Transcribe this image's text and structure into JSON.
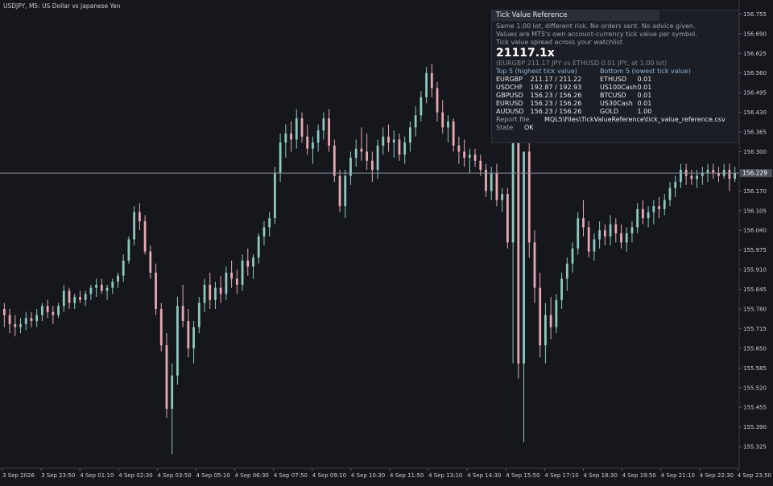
{
  "title": "USDJPY, M5:  US Dollar vs Japanese Yen",
  "price_axis": {
    "ticks": [
      "156.755",
      "156.690",
      "156.625",
      "156.560",
      "156.495",
      "156.430",
      "156.365",
      "156.300",
      "156.235",
      "156.170",
      "156.105",
      "156.040",
      "155.975",
      "155.910",
      "155.845",
      "155.780",
      "155.715",
      "155.650",
      "155.585",
      "155.520",
      "155.455",
      "155.390",
      "155.325"
    ],
    "current_price": "156.229"
  },
  "time_axis": {
    "labels": [
      "3 Sep 2026",
      "3 Sep 23:50",
      "4 Sep 01:10",
      "4 Sep 02:30",
      "4 Sep 03:50",
      "4 Sep 05:10",
      "4 Sep 06:30",
      "4 Sep 07:50",
      "4 Sep 09:10",
      "4 Sep 10:30",
      "4 Sep 11:50",
      "4 Sep 13:10",
      "4 Sep 14:30",
      "4 Sep 15:50",
      "4 Sep 17:10",
      "4 Sep 18:30",
      "4 Sep 19:50",
      "4 Sep 21:10",
      "4 Sep 22:30",
      "4 Sep 23:50"
    ]
  },
  "colors": {
    "background": "#15171c",
    "bull": "#8fc9bd",
    "bear": "#e8a9b3",
    "text": "#c8ccd4",
    "crosshair": "#8a8f98"
  },
  "panel": {
    "header": "Tick Value Reference",
    "lines": [
      "Same 1.00 lot, different risk. No orders sent. No advice given.",
      "Values are MT5's own account-currency tick value per symbol.",
      "Tick value spread across your watchlist"
    ],
    "ratio": "21117.1x",
    "ratio_detail": "(EURGBP 211.17 JPY vs ETHUSD 0.01 JPY, at 1.00 lot)",
    "top_header": "Top 5 (highest tick value)",
    "bottom_header": "Bottom 5 (lowest tick value)",
    "top": [
      {
        "symbol": "EURGBP",
        "value": "211.17 / 211.22"
      },
      {
        "symbol": "USDCHF",
        "value": "192.87 / 192.93"
      },
      {
        "symbol": "GBPUSD",
        "value": "156.23 / 156.26"
      },
      {
        "symbol": "EURUSD",
        "value": "156.23 / 156.26"
      },
      {
        "symbol": "AUDUSD",
        "value": "156.23 / 156.26"
      }
    ],
    "bottom": [
      {
        "symbol": "ETHUSD",
        "value": "0.01"
      },
      {
        "symbol": "US100Cash",
        "value": "0.01"
      },
      {
        "symbol": "BTCUSD",
        "value": "0.01"
      },
      {
        "symbol": "US30Cash",
        "value": "0.01"
      },
      {
        "symbol": "GOLD",
        "value": "1.00"
      }
    ],
    "report_label": "Report file",
    "report_value": "MQL5\\Files\\TickValueReference\\tick_value_reference.csv",
    "state_label": "State",
    "state_value": "OK"
  },
  "chart_data": {
    "type": "candlestick",
    "symbol": "USDJPY",
    "timeframe": "M5",
    "ylim": [
      155.28,
      156.78
    ],
    "grid": false,
    "candles": [
      [
        155.78,
        155.8,
        155.72,
        155.76
      ],
      [
        155.76,
        155.78,
        155.7,
        155.73
      ],
      [
        155.73,
        155.76,
        155.69,
        155.72
      ],
      [
        155.72,
        155.75,
        155.7,
        155.73
      ],
      [
        155.73,
        155.77,
        155.71,
        155.75
      ],
      [
        155.75,
        155.77,
        155.72,
        155.74
      ],
      [
        155.74,
        155.78,
        155.72,
        155.76
      ],
      [
        155.76,
        155.8,
        155.74,
        155.79
      ],
      [
        155.79,
        155.81,
        155.75,
        155.77
      ],
      [
        155.77,
        155.79,
        155.73,
        155.76
      ],
      [
        155.76,
        155.8,
        155.75,
        155.79
      ],
      [
        155.79,
        155.86,
        155.77,
        155.84
      ],
      [
        155.84,
        155.85,
        155.78,
        155.8
      ],
      [
        155.8,
        155.83,
        155.78,
        155.82
      ],
      [
        155.82,
        155.84,
        155.8,
        155.81
      ],
      [
        155.81,
        155.84,
        155.79,
        155.83
      ],
      [
        155.83,
        155.86,
        155.81,
        155.85
      ],
      [
        155.85,
        155.88,
        155.82,
        155.86
      ],
      [
        155.86,
        155.88,
        155.83,
        155.84
      ],
      [
        155.84,
        155.86,
        155.81,
        155.85
      ],
      [
        155.85,
        155.88,
        155.83,
        155.87
      ],
      [
        155.87,
        155.9,
        155.85,
        155.89
      ],
      [
        155.89,
        155.96,
        155.87,
        155.94
      ],
      [
        155.94,
        156.02,
        155.93,
        156.01
      ],
      [
        156.01,
        156.12,
        155.99,
        156.1
      ],
      [
        156.1,
        156.13,
        156.04,
        156.07
      ],
      [
        156.07,
        156.09,
        155.96,
        155.97
      ],
      [
        155.97,
        155.99,
        155.88,
        155.9
      ],
      [
        155.9,
        155.93,
        155.76,
        155.78
      ],
      [
        155.78,
        155.8,
        155.64,
        155.66
      ],
      [
        155.66,
        155.7,
        155.42,
        155.45
      ],
      [
        155.45,
        155.6,
        155.3,
        155.56
      ],
      [
        155.56,
        155.82,
        155.53,
        155.79
      ],
      [
        155.79,
        155.86,
        155.72,
        155.74
      ],
      [
        155.74,
        155.78,
        155.62,
        155.65
      ],
      [
        155.65,
        155.74,
        155.6,
        155.72
      ],
      [
        155.72,
        155.82,
        155.7,
        155.8
      ],
      [
        155.8,
        155.88,
        155.77,
        155.86
      ],
      [
        155.86,
        155.9,
        155.78,
        155.81
      ],
      [
        155.81,
        155.87,
        155.78,
        155.85
      ],
      [
        155.85,
        155.89,
        155.8,
        155.83
      ],
      [
        155.83,
        155.92,
        155.81,
        155.9
      ],
      [
        155.9,
        155.94,
        155.85,
        155.88
      ],
      [
        155.88,
        155.91,
        155.83,
        155.86
      ],
      [
        155.86,
        155.96,
        155.84,
        155.94
      ],
      [
        155.94,
        155.98,
        155.89,
        155.92
      ],
      [
        155.92,
        155.96,
        155.88,
        155.95
      ],
      [
        155.95,
        156.03,
        155.93,
        156.02
      ],
      [
        156.02,
        156.07,
        155.99,
        156.05
      ],
      [
        156.05,
        156.1,
        156.02,
        156.08
      ],
      [
        156.08,
        156.25,
        156.06,
        156.23
      ],
      [
        156.23,
        156.36,
        156.2,
        156.33
      ],
      [
        156.33,
        156.39,
        156.28,
        156.36
      ],
      [
        156.36,
        156.4,
        156.3,
        156.34
      ],
      [
        156.34,
        156.44,
        156.31,
        156.41
      ],
      [
        156.41,
        156.43,
        156.33,
        156.35
      ],
      [
        156.35,
        156.39,
        156.29,
        156.31
      ],
      [
        156.31,
        156.35,
        156.26,
        156.33
      ],
      [
        156.33,
        156.39,
        156.3,
        156.37
      ],
      [
        156.37,
        156.43,
        156.34,
        156.41
      ],
      [
        156.41,
        156.44,
        156.3,
        156.32
      ],
      [
        156.32,
        156.34,
        156.2,
        156.22
      ],
      [
        156.22,
        156.24,
        156.1,
        156.12
      ],
      [
        156.12,
        156.24,
        156.08,
        156.22
      ],
      [
        156.22,
        156.3,
        156.19,
        156.28
      ],
      [
        156.28,
        156.34,
        156.25,
        156.31
      ],
      [
        156.31,
        156.38,
        156.27,
        156.3
      ],
      [
        156.3,
        156.36,
        156.24,
        156.27
      ],
      [
        156.27,
        156.3,
        156.2,
        156.24
      ],
      [
        156.24,
        156.34,
        156.21,
        156.32
      ],
      [
        156.32,
        156.38,
        156.29,
        156.35
      ],
      [
        156.35,
        156.39,
        156.3,
        156.33
      ],
      [
        156.33,
        156.37,
        156.28,
        156.34
      ],
      [
        156.34,
        156.36,
        156.27,
        156.29
      ],
      [
        156.29,
        156.35,
        156.26,
        156.33
      ],
      [
        156.33,
        156.4,
        156.3,
        156.38
      ],
      [
        156.38,
        156.45,
        156.35,
        156.42
      ],
      [
        156.42,
        156.5,
        156.4,
        156.48
      ],
      [
        156.48,
        156.58,
        156.46,
        156.56
      ],
      [
        156.56,
        156.59,
        156.48,
        156.51
      ],
      [
        156.51,
        156.53,
        156.4,
        156.43
      ],
      [
        156.43,
        156.47,
        156.36,
        156.38
      ],
      [
        156.38,
        156.42,
        156.33,
        156.4
      ],
      [
        156.4,
        156.41,
        156.3,
        156.32
      ],
      [
        156.32,
        156.35,
        156.26,
        156.3
      ],
      [
        156.3,
        156.34,
        156.25,
        156.28
      ],
      [
        156.28,
        156.31,
        156.23,
        156.29
      ],
      [
        156.29,
        156.31,
        156.25,
        156.27
      ],
      [
        156.27,
        156.29,
        156.22,
        156.24
      ],
      [
        156.24,
        156.26,
        156.15,
        156.17
      ],
      [
        156.17,
        156.25,
        156.14,
        156.23
      ],
      [
        156.23,
        156.26,
        156.12,
        156.14
      ],
      [
        156.14,
        156.18,
        156.1,
        156.16
      ],
      [
        156.16,
        156.18,
        155.98,
        156.0
      ],
      [
        156.0,
        156.05,
        155.6,
        156.35
      ],
      [
        156.35,
        156.42,
        155.55,
        155.6
      ],
      [
        155.6,
        156.28,
        155.34,
        156.3
      ],
      [
        156.3,
        156.36,
        155.95,
        156.0
      ],
      [
        156.0,
        156.04,
        155.8,
        155.85
      ],
      [
        155.85,
        155.9,
        155.62,
        155.66
      ],
      [
        155.66,
        155.8,
        155.6,
        155.76
      ],
      [
        155.76,
        155.82,
        155.68,
        155.72
      ],
      [
        155.72,
        155.83,
        155.7,
        155.81
      ],
      [
        155.81,
        155.9,
        155.78,
        155.88
      ],
      [
        155.88,
        155.95,
        155.84,
        155.93
      ],
      [
        155.93,
        156.0,
        155.9,
        155.98
      ],
      [
        155.98,
        156.1,
        155.96,
        156.08
      ],
      [
        156.08,
        156.14,
        156.02,
        156.05
      ],
      [
        156.05,
        156.07,
        155.95,
        155.97
      ],
      [
        155.97,
        156.03,
        155.94,
        156.01
      ],
      [
        156.01,
        156.07,
        155.98,
        156.04
      ],
      [
        156.04,
        156.06,
        155.99,
        156.02
      ],
      [
        156.02,
        156.09,
        155.99,
        156.06
      ],
      [
        156.06,
        156.08,
        156.0,
        156.03
      ],
      [
        156.03,
        156.06,
        155.98,
        156.0
      ],
      [
        156.0,
        156.05,
        155.97,
        156.03
      ],
      [
        156.03,
        156.07,
        156.0,
        156.05
      ],
      [
        156.05,
        156.13,
        156.03,
        156.11
      ],
      [
        156.11,
        156.14,
        156.06,
        156.08
      ],
      [
        156.08,
        156.12,
        156.05,
        156.1
      ],
      [
        156.1,
        156.14,
        156.06,
        156.12
      ],
      [
        156.12,
        156.15,
        156.08,
        156.11
      ],
      [
        156.11,
        156.16,
        156.09,
        156.14
      ],
      [
        156.14,
        156.2,
        156.12,
        156.18
      ],
      [
        156.18,
        156.22,
        156.15,
        156.2
      ],
      [
        156.2,
        156.26,
        156.18,
        156.24
      ],
      [
        156.24,
        156.26,
        156.19,
        156.22
      ],
      [
        156.22,
        156.24,
        156.19,
        156.21
      ],
      [
        156.21,
        156.24,
        156.18,
        156.22
      ],
      [
        156.22,
        156.25,
        156.19,
        156.23
      ],
      [
        156.23,
        156.26,
        156.2,
        156.24
      ],
      [
        156.24,
        156.26,
        156.21,
        156.23
      ],
      [
        156.23,
        156.25,
        156.2,
        156.22
      ],
      [
        156.22,
        156.26,
        156.21,
        156.24
      ],
      [
        156.24,
        156.26,
        156.17,
        156.21
      ],
      [
        156.21,
        156.25,
        156.2,
        156.23
      ]
    ]
  }
}
